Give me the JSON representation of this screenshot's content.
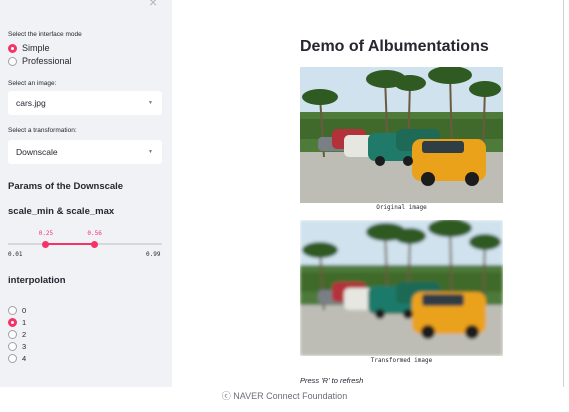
{
  "sidebar": {
    "close_glyph": "×",
    "mode_label": "Select the interface mode",
    "modes": [
      {
        "label": "Simple",
        "selected": true
      },
      {
        "label": "Professional",
        "selected": false
      }
    ],
    "image_label": "Select an image:",
    "image_value": "cars.jpg",
    "transform_label": "Select a transformation:",
    "transform_value": "Downscale",
    "params_heading": "Params of the Downscale",
    "slider_heading": "scale_min & scale_max",
    "slider": {
      "min_label": "0.01",
      "max_label": "0.99",
      "low": 0.25,
      "high": 0.56,
      "low_label": "0.25",
      "high_label": "0.56"
    },
    "interp_heading": "interpolation",
    "interp_options": [
      {
        "label": "0",
        "selected": false
      },
      {
        "label": "1",
        "selected": true
      },
      {
        "label": "2",
        "selected": false
      },
      {
        "label": "3",
        "selected": false
      },
      {
        "label": "4",
        "selected": false
      }
    ]
  },
  "main": {
    "title": "Demo of Albumentations",
    "original_caption": "Original image",
    "transformed_caption": "Transformed image",
    "refresh_hint": "Press 'R' to refresh"
  },
  "footer": "ⓒ NAVER Connect Foundation",
  "colors": {
    "accent": "#f63366",
    "sidebar_bg": "#f0f2f6"
  }
}
